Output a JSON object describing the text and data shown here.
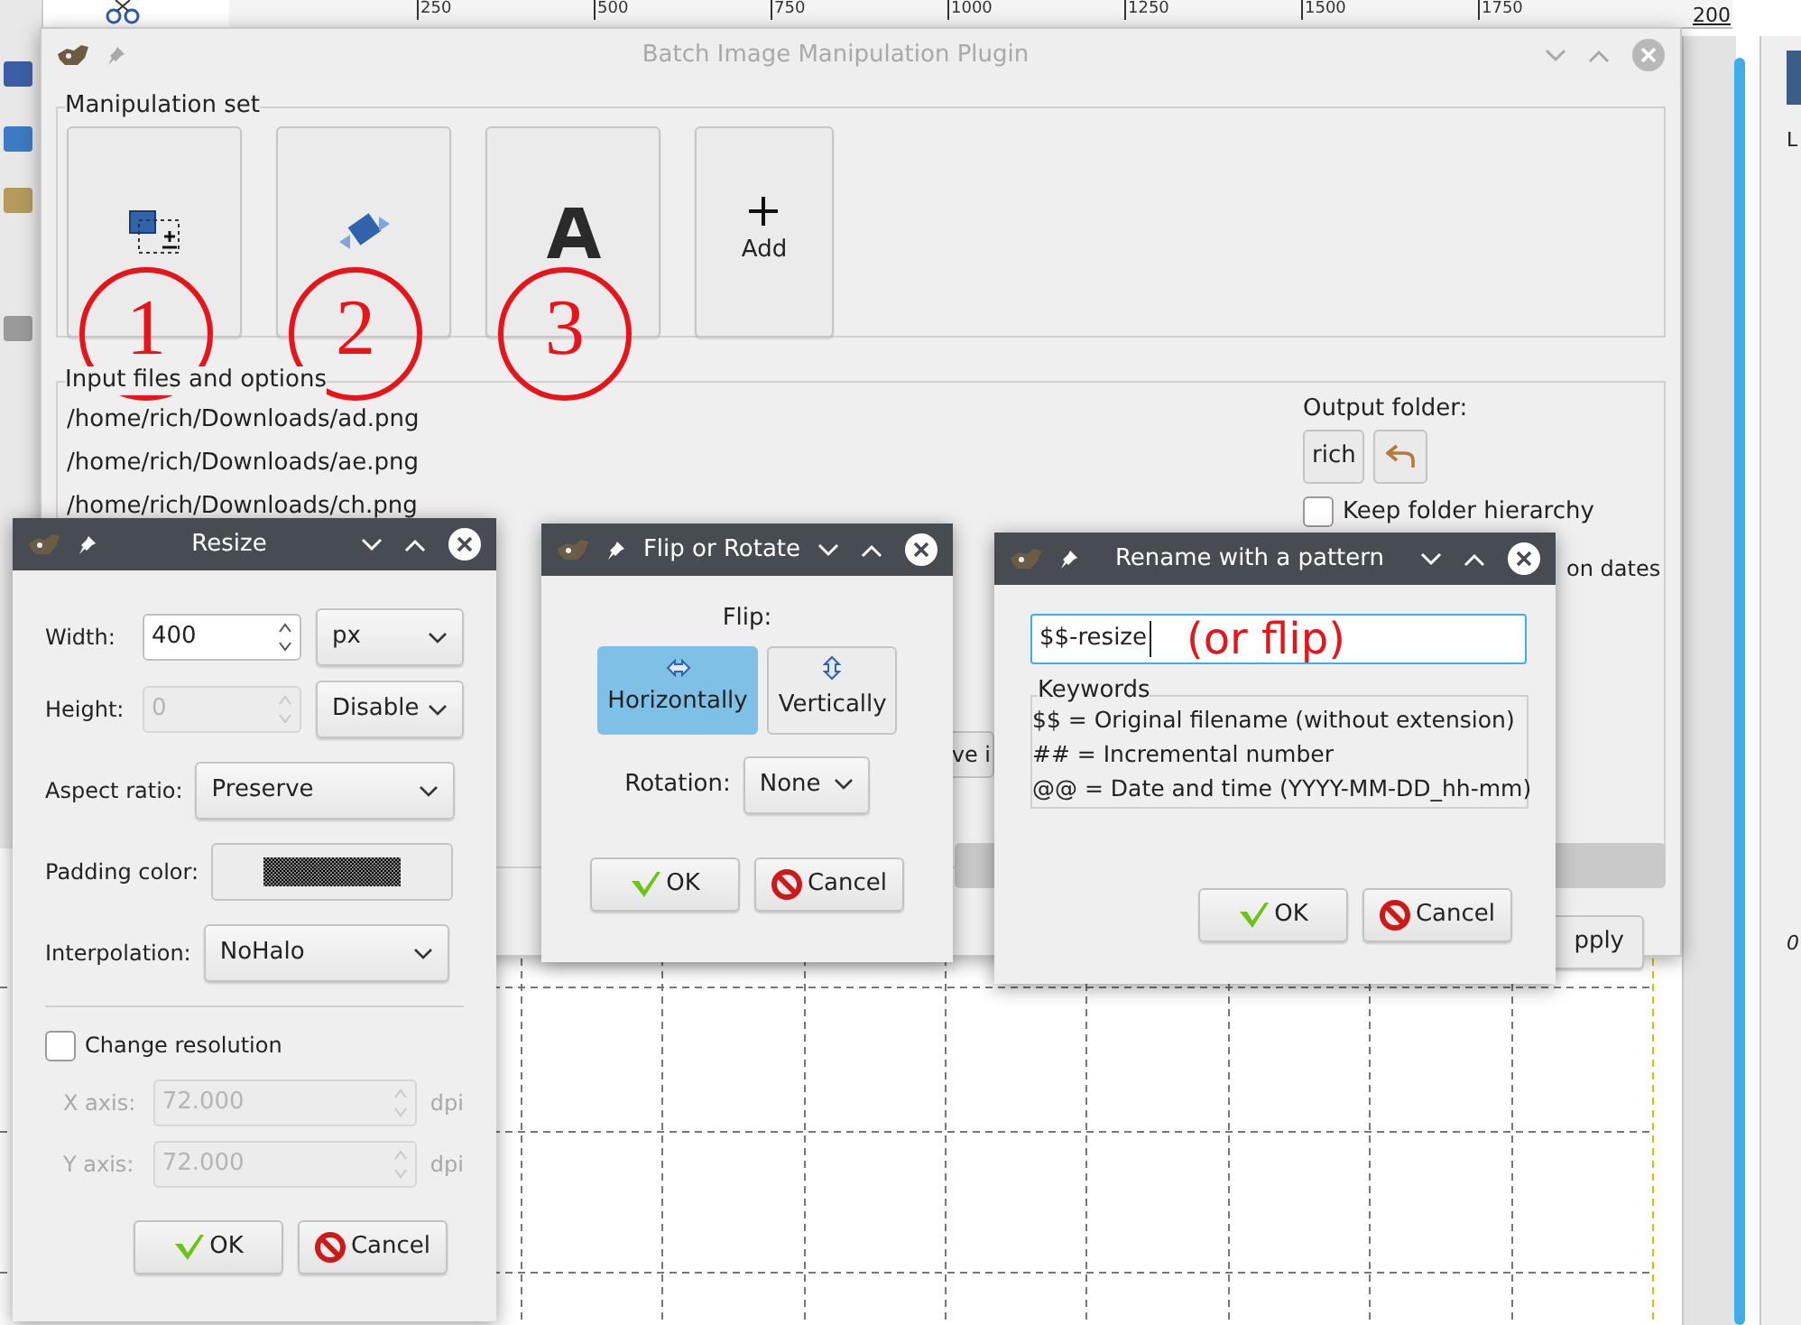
{
  "background": {
    "ruler_labels": [
      "250",
      "500",
      "750",
      "1000",
      "1250",
      "1500",
      "1750"
    ],
    "zoom": "200",
    "dock_texts": [
      "L",
      "0"
    ]
  },
  "main_window": {
    "title": "Batch Image Manipulation Plugin",
    "manipulation_set": {
      "label": "Manipulation set",
      "items": [
        {
          "kind": "resize",
          "annotation": "1"
        },
        {
          "kind": "flip",
          "annotation": "2"
        },
        {
          "kind": "text",
          "annotation": "3"
        },
        {
          "kind": "add",
          "label": "Add"
        }
      ]
    },
    "input": {
      "label": "Input files and options",
      "files": [
        "/home/rich/Downloads/ad.png",
        "/home/rich/Downloads/ae.png",
        "/home/rich/Downloads/ch.png"
      ],
      "output_folder_label": "Output folder:",
      "folder_button": "rich",
      "keep_hierarchy": {
        "label": "Keep folder hierarchy",
        "checked": false
      },
      "partial_option": "on dates",
      "partial_button": "ve i",
      "apply_button": "pply"
    }
  },
  "resize_dialog": {
    "title": "Resize",
    "width": {
      "label": "Width:",
      "value": "400",
      "unit": "px",
      "disabled": false
    },
    "height": {
      "label": "Height:",
      "value": "0",
      "unit": "Disable",
      "disabled": true
    },
    "aspect_ratio": {
      "label": "Aspect ratio:",
      "value": "Preserve"
    },
    "padding_color": {
      "label": "Padding color:"
    },
    "interpolation": {
      "label": "Interpolation:",
      "value": "NoHalo"
    },
    "change_resolution": {
      "label": "Change resolution",
      "checked": false
    },
    "axes": [
      {
        "label": "X axis:",
        "value": "72.000",
        "unit": "dpi",
        "disabled": true
      },
      {
        "label": "Y axis:",
        "value": "72.000",
        "unit": "dpi",
        "disabled": true
      }
    ],
    "buttons": [
      {
        "label": "OK",
        "kind": "ok"
      },
      {
        "label": "Cancel",
        "kind": "cancel"
      }
    ]
  },
  "flip_dialog": {
    "title": "Flip or Rotate",
    "flip_label": "Flip:",
    "flip_options": [
      {
        "label": "Horizontally",
        "kind": "horizontal",
        "selected": true
      },
      {
        "label": "Vertically",
        "kind": "vertical",
        "selected": false
      }
    ],
    "rotation": {
      "label": "Rotation:",
      "value": "None"
    },
    "buttons": [
      {
        "label": "OK",
        "kind": "ok"
      },
      {
        "label": "Cancel",
        "kind": "cancel"
      }
    ]
  },
  "rename_dialog": {
    "title": "Rename with a pattern",
    "pattern": "$$-resize",
    "annotation": "(or flip)",
    "keywords_label": "Keywords",
    "keywords": [
      "$$ = Original filename (without extension)",
      "## = Incremental number",
      "@@ = Date and time (YYYY-MM-DD_hh-mm)"
    ],
    "buttons": [
      {
        "label": "OK",
        "kind": "ok"
      },
      {
        "label": "Cancel",
        "kind": "cancel"
      }
    ]
  }
}
